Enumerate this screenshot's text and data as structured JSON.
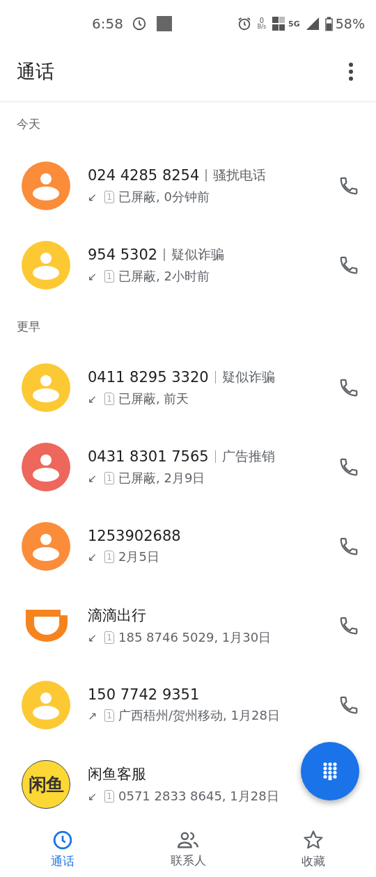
{
  "status_bar": {
    "time": "6:58",
    "net_speed": "0",
    "net_unit": "B/s",
    "network": "5G",
    "battery": "58%"
  },
  "header": {
    "title": "通话"
  },
  "sections": [
    {
      "label": "今天",
      "calls": [
        {
          "avatar": {
            "kind": "person",
            "color": "#fb8c3a"
          },
          "name": "024 4285 8254",
          "tag": "骚扰电话",
          "direction": "↙",
          "sim": "1",
          "detail": "已屏蔽, 0分钟前"
        },
        {
          "avatar": {
            "kind": "person",
            "color": "#fcc934"
          },
          "name": "954 5302",
          "tag": "疑似诈骗",
          "direction": "↙",
          "sim": "1",
          "detail": "已屏蔽, 2小时前"
        }
      ]
    },
    {
      "label": "更早",
      "calls": [
        {
          "avatar": {
            "kind": "person",
            "color": "#fcc934"
          },
          "name": "0411 8295 3320",
          "tag": "疑似诈骗",
          "direction": "↙",
          "sim": "1",
          "detail": "已屏蔽, 前天"
        },
        {
          "avatar": {
            "kind": "person",
            "color": "#ee675c"
          },
          "name": "0431 8301 7565",
          "tag": "广告推销",
          "direction": "↙",
          "sim": "1",
          "detail": "已屏蔽, 2月9日"
        },
        {
          "avatar": {
            "kind": "person",
            "color": "#fb8c3a"
          },
          "name": "1253902688",
          "direction": "↙",
          "sim": "1",
          "detail": "2月5日"
        },
        {
          "avatar": {
            "kind": "cup-logo",
            "color": "#f5841f"
          },
          "name": "滴滴出行",
          "direction": "↙",
          "sim": "1",
          "detail": "185 8746 5029, 1月30日"
        },
        {
          "avatar": {
            "kind": "person",
            "color": "#fcc934"
          },
          "name": "150 7742 9351",
          "direction": "↗",
          "sim": "1",
          "detail": "广西梧州/贺州移动, 1月28日"
        },
        {
          "avatar": {
            "kind": "text-logo",
            "color": "#fdd835",
            "text": "闲鱼"
          },
          "name": "闲鱼客服",
          "direction": "↙",
          "sim": "1",
          "detail": "0571 2833 8645, 1月28日"
        }
      ]
    }
  ],
  "tabs": [
    {
      "label": "通话",
      "selected": true
    },
    {
      "label": "联系人",
      "selected": false
    },
    {
      "label": "收藏",
      "selected": false
    }
  ]
}
